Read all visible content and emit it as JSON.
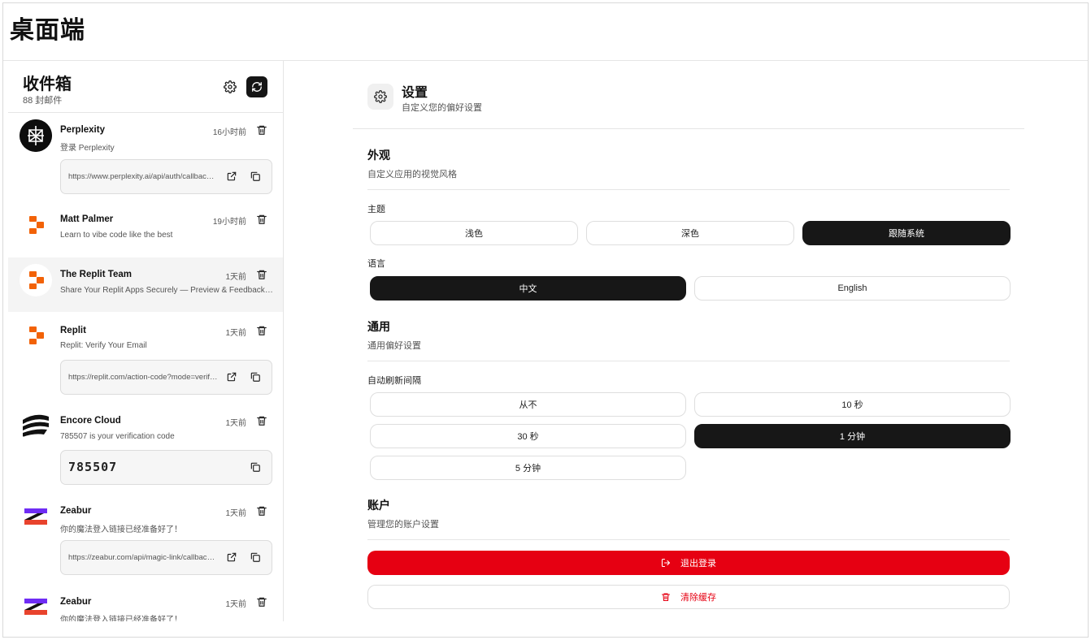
{
  "page": {
    "title": "桌面端"
  },
  "inbox": {
    "title": "收件箱",
    "count": "88 封邮件",
    "mails": [
      {
        "sender": "Perplexity",
        "subject": "登录 Perplexity",
        "time": "16小时前",
        "link": "https://www.perplexity.ai/api/auth/callback/email?callbackUrl=..."
      },
      {
        "sender": "Matt Palmer",
        "subject": "Learn to vibe code like the best",
        "time": "19小时前"
      },
      {
        "sender": "The Replit Team",
        "subject": "Share Your Replit Apps Securely — Preview & Feedback ...",
        "time": "1天前"
      },
      {
        "sender": "Replit",
        "subject": "Replit: Verify Your Email",
        "time": "1天前",
        "link": "https://replit.com/action-code?mode=verifyEmail..."
      },
      {
        "sender": "Encore Cloud",
        "subject": "785507 is your verification code",
        "time": "1天前",
        "code": "785507"
      },
      {
        "sender": "Zeabur",
        "subject": "你的魔法登入链接已经准备好了！",
        "time": "1天前",
        "link": "https://zeabur.com/api/magic-link/callback?token=..."
      },
      {
        "sender": "Zeabur",
        "subject": "你的魔法登入链接已经准备好了！",
        "time": "1天前"
      }
    ]
  },
  "settings": {
    "title": "设置",
    "subtitle": "自定义您的偏好设置",
    "appearance": {
      "title": "外观",
      "subtitle": "自定义应用的视觉风格",
      "theme_label": "主题",
      "themes": [
        "浅色",
        "深色",
        "跟随系统"
      ],
      "language_label": "语言",
      "languages": [
        "中文",
        "English"
      ]
    },
    "general": {
      "title": "通用",
      "subtitle": "通用偏好设置",
      "refresh_label": "自动刷新间隔",
      "intervals": [
        "从不",
        "10 秒",
        "30 秒",
        "1 分钟",
        "5 分钟"
      ]
    },
    "account": {
      "title": "账户",
      "subtitle": "管理您的账户设置",
      "logout": "退出登录",
      "clear_cache": "清除缓存"
    }
  },
  "colors": {
    "danger": "#e60012",
    "selected": "#171717",
    "replit": "#f26207"
  }
}
